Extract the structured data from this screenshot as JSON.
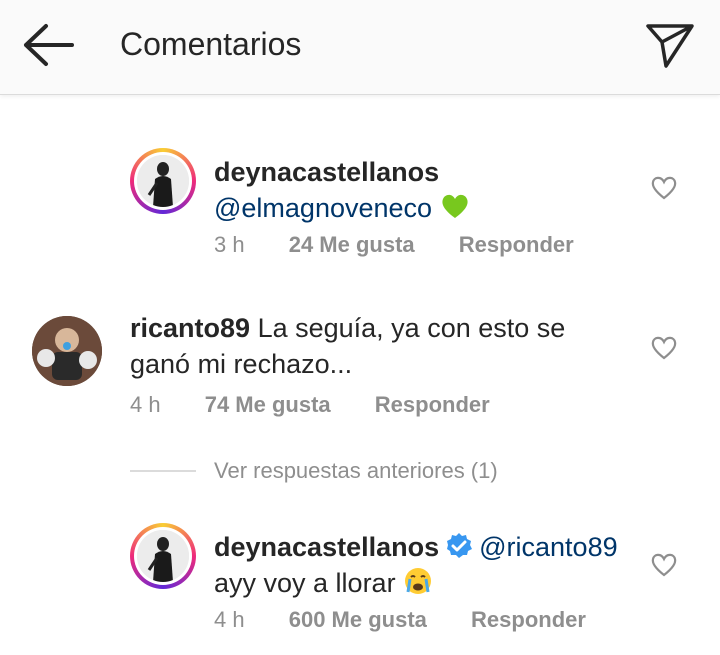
{
  "header": {
    "title": "Comentarios",
    "back_icon": "arrow-left-icon",
    "send_icon": "paper-plane-icon"
  },
  "comments": [
    {
      "username": "deynacastellanos",
      "verified": false,
      "mention": "@elmagnoveneco",
      "text": "",
      "emoji": "green-heart",
      "time": "3 h",
      "likes": "24 Me gusta",
      "reply": "Responder"
    },
    {
      "username": "ricanto89",
      "text_line1": "La seguía, ya con esto se",
      "text_line2": "ganó mi rechazo...",
      "time": "4 h",
      "likes": "74 Me gusta",
      "reply": "Responder"
    },
    {
      "username": "deynacastellanos",
      "verified": true,
      "mention": "@ricanto89",
      "text": "ayy voy a llorar",
      "emoji": "crying-face",
      "time": "4 h",
      "likes": "600 Me gusta",
      "reply": "Responder"
    }
  ],
  "view_replies": "Ver respuestas anteriores (1)",
  "colors": {
    "mention": "#003569",
    "meta": "#8e8e8e",
    "verified": "#3897f0",
    "green_heart": "#78c81e"
  }
}
